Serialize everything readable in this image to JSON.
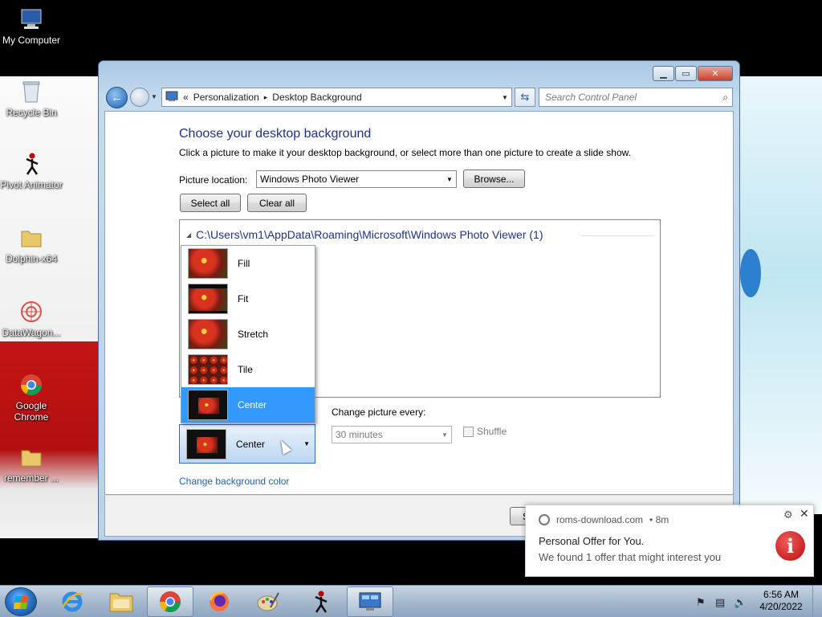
{
  "desktop": {
    "icons": [
      {
        "label": "My Computer",
        "icon": "computer-icon"
      },
      {
        "label": "Recycle Bin",
        "icon": "recycle-bin-icon"
      },
      {
        "label": "Pivot Animator",
        "icon": "pivot-animator-icon"
      },
      {
        "label": "Dolphin-x64",
        "icon": "folder-icon"
      },
      {
        "label": "DataWagon...",
        "icon": "datawagon-icon"
      },
      {
        "label": "Google Chrome",
        "icon": "chrome-icon"
      },
      {
        "label": "remember ...",
        "icon": "folder-icon"
      }
    ]
  },
  "window": {
    "address": {
      "chevron": "«",
      "segments": [
        "Personalization",
        "Desktop Background"
      ],
      "separator": "▸"
    },
    "search": {
      "placeholder": "Search Control Panel"
    },
    "heading": "Choose your desktop background",
    "subtitle": "Click a picture to make it your desktop background, or select more than one picture to create a slide show.",
    "picture_location": {
      "label": "Picture location:",
      "value": "Windows Photo Viewer"
    },
    "browse_label": "Browse...",
    "select_all_label": "Select all",
    "clear_all_label": "Clear all",
    "group_path": "C:\\Users\\vm1\\AppData\\Roaming\\Microsoft\\Windows Photo Viewer (1)",
    "picture_position": {
      "selected": "Center",
      "options": [
        "Fill",
        "Fit",
        "Stretch",
        "Tile",
        "Center"
      ]
    },
    "change_picture_every": {
      "label": "Change picture every:",
      "value": "30 minutes"
    },
    "shuffle_label": "Shuffle",
    "change_bg_color_label": "Change background color",
    "save_partial": "S"
  },
  "notification": {
    "source": "roms-download.com",
    "age": "• 8m",
    "title": "Personal Offer for You.",
    "message": "We found 1 offer that might interest you"
  },
  "taskbar": {
    "apps": [
      "internet-explorer-icon",
      "explorer-icon",
      "chrome-icon",
      "firefox-icon",
      "paint-icon",
      "pivot-icon",
      "control-panel-icon"
    ],
    "time": "6:56 AM",
    "date": "4/20/2022"
  },
  "colors": {
    "accent": "#3399ff",
    "link": "#1e62b6",
    "heading": "#1e3287"
  }
}
